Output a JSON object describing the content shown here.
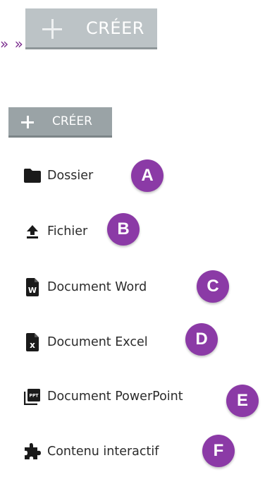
{
  "intro": {
    "quote_tail": "» »"
  },
  "create_button_large": {
    "label": "CRÉER",
    "icon": "plus-icon"
  },
  "create_button_small": {
    "label": "CRÉER",
    "icon": "plus-icon"
  },
  "menu": {
    "items": [
      {
        "label": "Dossier",
        "icon": "folder-icon",
        "badge": "A"
      },
      {
        "label": "Fichier",
        "icon": "upload-icon",
        "badge": "B"
      },
      {
        "label": "Document Word",
        "icon": "word-document-icon",
        "badge": "C"
      },
      {
        "label": "Document Excel",
        "icon": "excel-document-icon",
        "badge": "D"
      },
      {
        "label": "Document PowerPoint",
        "icon": "powerpoint-document-icon",
        "badge": "E"
      },
      {
        "label": "Contenu interactif",
        "icon": "puzzle-icon",
        "badge": "F"
      }
    ]
  },
  "colors": {
    "badge": "#8b3aa6",
    "button_large": "#bcc3c6",
    "button_small": "#9aa3a6",
    "quote_text": "#7b2d8e"
  }
}
